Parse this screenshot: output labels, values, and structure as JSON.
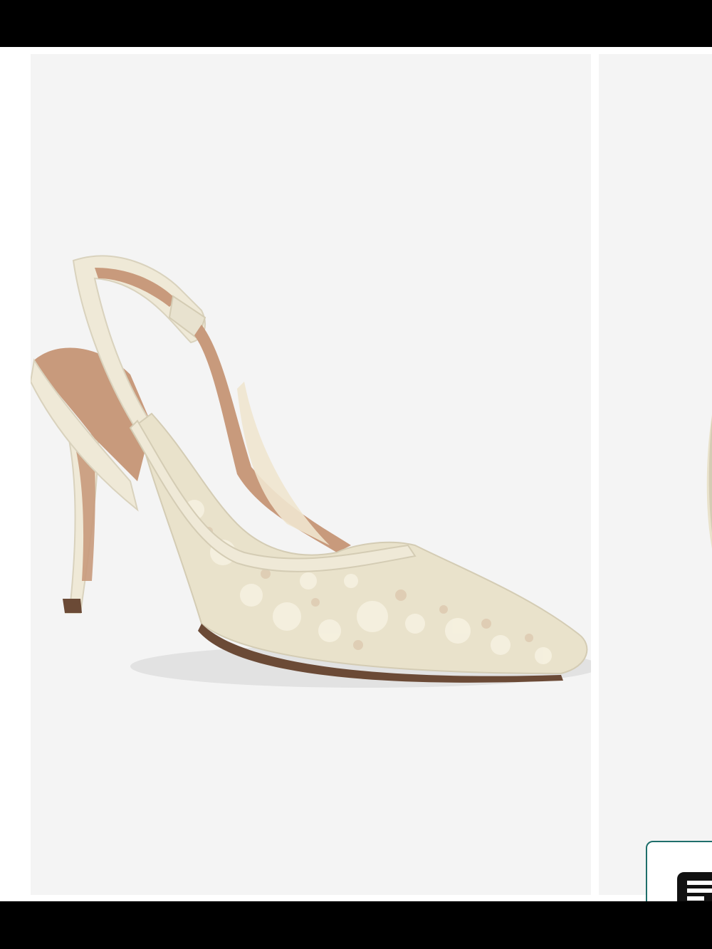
{
  "gallery": {
    "main_image": {
      "icon": "lace-slingback-pump-image"
    },
    "next_image": {
      "icon": "partial-shoe-image"
    }
  },
  "chat": {
    "icon": "chat-bubble-icon",
    "accent_color": "#1f6f6b"
  },
  "colors": {
    "background": "#f4f4f4",
    "cream": "#efe9d7",
    "nude": "#c89a7c",
    "bars": "#000000"
  }
}
